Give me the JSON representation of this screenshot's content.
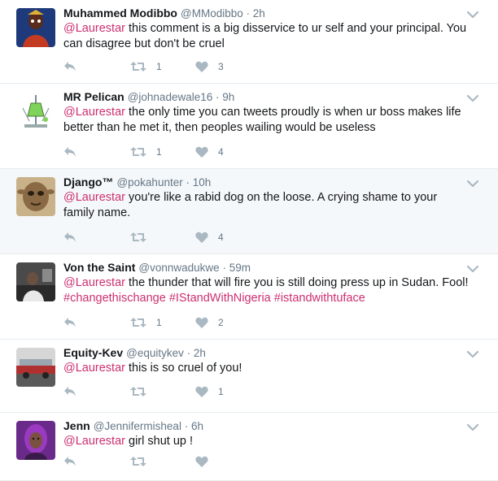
{
  "tweets": [
    {
      "name": "Muhammed Modibbo",
      "handle": "@MModibbo",
      "time": "2h",
      "body": [
        {
          "text": "@Laurestar",
          "kind": "mention"
        },
        {
          "text": " this comment is a big disservice to ur self and your principal. You can disagree but don't be cruel",
          "kind": "text"
        }
      ],
      "retweets": "1",
      "likes": "3",
      "avatar": "cartoon-avatar",
      "highlighted": false
    },
    {
      "name": "MR Pelican",
      "handle": "@johnadewale16",
      "time": "9h",
      "body": [
        {
          "text": "@Laurestar",
          "kind": "mention"
        },
        {
          "text": " the only time you can tweets proudly is when ur boss makes life better than he met it, then peoples wailing would be useless",
          "kind": "text"
        }
      ],
      "retweets": "1",
      "likes": "4",
      "avatar": "lab-flask-avatar",
      "highlighted": false
    },
    {
      "name": "Django™",
      "handle": "@pokahunter",
      "time": "10h",
      "body": [
        {
          "text": "@Laurestar",
          "kind": "mention"
        },
        {
          "text": " you're like a rabid dog on the loose. A crying shame to your family name.",
          "kind": "text"
        }
      ],
      "retweets": "",
      "likes": "4",
      "avatar": "creature-avatar",
      "highlighted": true
    },
    {
      "name": "Von the Saint",
      "handle": "@vonnwadukwe",
      "time": "59m",
      "body": [
        {
          "text": "@Laurestar",
          "kind": "mention"
        },
        {
          "text": " the thunder that will fire you is still doing press up in Sudan. Fool! ",
          "kind": "text"
        },
        {
          "text": "#changethischange",
          "kind": "hashtag"
        },
        {
          "text": " ",
          "kind": "text"
        },
        {
          "text": "#IStandWithNigeria",
          "kind": "hashtag"
        },
        {
          "text": " ",
          "kind": "text"
        },
        {
          "text": "#istandwithtuface",
          "kind": "hashtag"
        }
      ],
      "retweets": "1",
      "likes": "2",
      "avatar": "photo-avatar",
      "highlighted": false
    },
    {
      "name": "Equity-Kev",
      "handle": "@equitykev",
      "time": "2h",
      "body": [
        {
          "text": "@Laurestar",
          "kind": "mention"
        },
        {
          "text": " this is so cruel of you!",
          "kind": "text"
        }
      ],
      "retweets": "",
      "likes": "1",
      "avatar": "vehicle-avatar",
      "highlighted": false
    },
    {
      "name": "Jenn",
      "handle": "@Jennifermisheal",
      "time": "6h",
      "body": [
        {
          "text": "@Laurestar",
          "kind": "mention"
        },
        {
          "text": " girl shut up !",
          "kind": "text"
        }
      ],
      "retweets": "",
      "likes": "",
      "avatar": "portrait-avatar",
      "highlighted": false
    }
  ],
  "colors": {
    "mention": "#cc2f70",
    "hashtag": "#cc2f70",
    "meta": "#657786",
    "icon": "#aab8c2",
    "highlight_bg": "#f5f8fa",
    "divider": "#e6ecf0"
  }
}
